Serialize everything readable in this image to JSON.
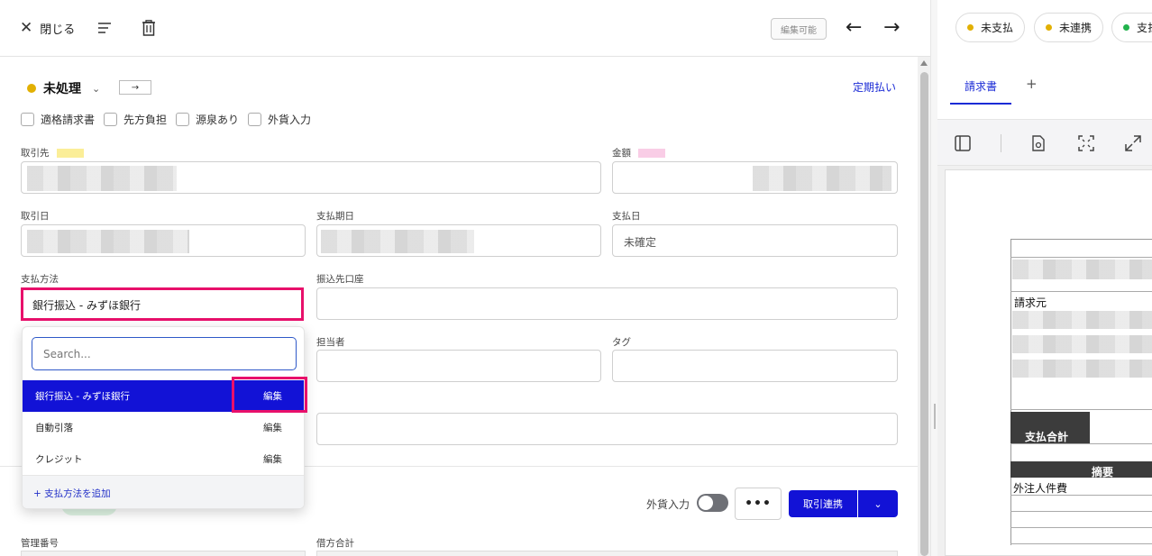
{
  "topbar": {
    "close_label": "閉じる",
    "edit_badge": "編集可能",
    "prev_label": "←",
    "next_label": "→"
  },
  "header": {
    "status_label": "未処理",
    "status_color": "#e2b003",
    "arrow_box": "→",
    "recurring_link": "定期払い"
  },
  "checkboxes": [
    {
      "label": "適格請求書",
      "checked": false
    },
    {
      "label": "先方負担",
      "checked": false
    },
    {
      "label": "源泉あり",
      "checked": false
    },
    {
      "label": "外貨入力",
      "checked": false
    }
  ],
  "fields": {
    "partner_label": "取引先",
    "amount_label": "金額",
    "deal_date_label": "取引日",
    "due_date_label": "支払期日",
    "payment_date_label": "支払日",
    "payment_date_value": "未確定",
    "payment_method_label": "支払方法",
    "payment_method_value": "銀行振込 - みずほ銀行",
    "transfer_account_label": "振込先口座",
    "assignee_label": "担当者",
    "tag_label": "タグ",
    "control_number_label": "管理番号",
    "debit_total_label": "借方合計"
  },
  "dropdown": {
    "search_placeholder": "Search...",
    "items": [
      {
        "label": "銀行振込 - みずほ銀行",
        "edit": "編集",
        "selected": true
      },
      {
        "label": "自動引落",
        "edit": "編集",
        "selected": false
      },
      {
        "label": "クレジット",
        "edit": "編集",
        "selected": false
      }
    ],
    "add_label": "+ 支払方法を追加"
  },
  "footer": {
    "fx_label": "外貨入力",
    "more_label": "•••",
    "link_button": "取引連携",
    "caret": "⌄"
  },
  "right": {
    "pills": [
      {
        "label": "未支払",
        "color": "#e2b003"
      },
      {
        "label": "未連携",
        "color": "#e2b003"
      },
      {
        "label": "支払",
        "color": "#22b24c"
      }
    ],
    "tab_invoice": "請求書",
    "tab_add": "+",
    "doc": {
      "billing_from": "請求元",
      "payment_total": "支払合計",
      "summary": "摘要",
      "item": "外注人件費"
    }
  },
  "colors": {
    "accent": "#1212d6",
    "highlight": "#e8106b",
    "link": "#1b2bd6"
  }
}
